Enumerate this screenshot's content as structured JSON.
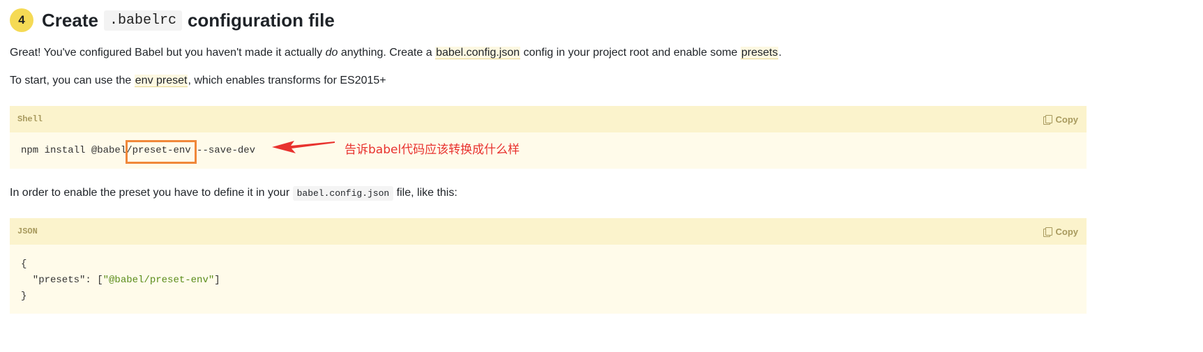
{
  "step": {
    "number": "4",
    "title_before": "Create",
    "title_code": ".babelrc",
    "title_after": "configuration file"
  },
  "intro": {
    "p1_a": "Great! You've configured Babel but you haven't made it actually ",
    "p1_em": "do",
    "p1_b": " anything. Create a ",
    "p1_link1": "babel.config.json",
    "p1_c": " config in your project root and enable some ",
    "p1_link2": "presets",
    "p1_d": ".",
    "p2_a": "To start, you can use the ",
    "p2_link": "env preset",
    "p2_b": ", which enables transforms for ES2015+"
  },
  "shell_block": {
    "language": "Shell",
    "copy_label": "Copy",
    "code_before": "npm install @babel/",
    "code_highlight": "preset-env",
    "code_after": " --save-dev"
  },
  "annotation": {
    "text": "告诉babel代码应该转换成什么样",
    "color": "#e8322e",
    "box_color": "#f0883a"
  },
  "middle": {
    "p_a": "In order to enable the preset you have to define it in your ",
    "p_code": "babel.config.json",
    "p_b": " file, like this:"
  },
  "json_block": {
    "language": "JSON",
    "copy_label": "Copy",
    "line1": "{",
    "line2_key": "  \"presets\": [",
    "line2_str": "\"@babel/preset-env\"",
    "line2_end": "]",
    "line3": "}"
  }
}
